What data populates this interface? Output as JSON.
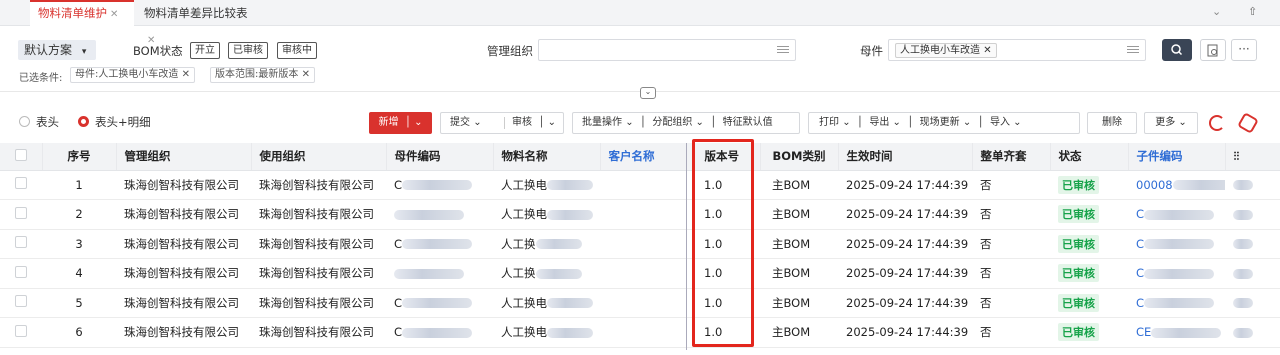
{
  "tabs": [
    {
      "label": "物料清单维护",
      "active": true
    },
    {
      "label": "物料清单差异比较表",
      "active": false
    }
  ],
  "tabbar_right": {
    "collapse": "⌄",
    "upload": "⇧"
  },
  "filter": {
    "scheme": "默认方案",
    "bom_status_label": "BOM状态",
    "bom_status_pills": [
      "开立",
      "已审核",
      "审核中"
    ],
    "org_label": "管理组织",
    "parent_label": "母件",
    "parent_tag": "人工换电小车改造",
    "conditions_label": "已选条件:",
    "conditions": [
      "母件:人工换电小车改造",
      "版本范围:最新版本"
    ]
  },
  "view": {
    "header_only": "表头",
    "header_detail": "表头+明细",
    "selected": "header_detail"
  },
  "toolbar": {
    "add": "新增",
    "submit": "提交",
    "audit": "审核",
    "batch": "批量操作",
    "assign_org": "分配组织",
    "feature_default": "特征默认值",
    "print": "打印",
    "export": "导出",
    "site_update": "现场更新",
    "import": "导入",
    "delete": "删除",
    "more": "更多"
  },
  "table": {
    "headers": [
      "序号",
      "管理组织",
      "使用组织",
      "母件编码",
      "物料名称",
      "客户名称",
      "版本号",
      "BOM类别",
      "生效时间",
      "整单齐套",
      "状态",
      "子件编码"
    ],
    "rows": [
      {
        "no": "1",
        "mgmt_org": "珠海创智科技有限公司",
        "use_org": "珠海创智科技有限公司",
        "parent_code": "C",
        "name": "人工换电",
        "customer": "",
        "version": "1.0",
        "bom_type": "主BOM",
        "effective": "2025-09-24 17:44:39",
        "complete": "否",
        "status": "已审核",
        "child_code": "00008"
      },
      {
        "no": "2",
        "mgmt_org": "珠海创智科技有限公司",
        "use_org": "珠海创智科技有限公司",
        "parent_code": "",
        "name": "人工换电",
        "customer": "",
        "version": "1.0",
        "bom_type": "主BOM",
        "effective": "2025-09-24 17:44:39",
        "complete": "否",
        "status": "已审核",
        "child_code": "C"
      },
      {
        "no": "3",
        "mgmt_org": "珠海创智科技有限公司",
        "use_org": "珠海创智科技有限公司",
        "parent_code": "C",
        "name": "人工换",
        "customer": "",
        "version": "1.0",
        "bom_type": "主BOM",
        "effective": "2025-09-24 17:44:39",
        "complete": "否",
        "status": "已审核",
        "child_code": "C"
      },
      {
        "no": "4",
        "mgmt_org": "珠海创智科技有限公司",
        "use_org": "珠海创智科技有限公司",
        "parent_code": "",
        "name": "人工换",
        "customer": "",
        "version": "1.0",
        "bom_type": "主BOM",
        "effective": "2025-09-24 17:44:39",
        "complete": "否",
        "status": "已审核",
        "child_code": "C"
      },
      {
        "no": "5",
        "mgmt_org": "珠海创智科技有限公司",
        "use_org": "珠海创智科技有限公司",
        "parent_code": "C",
        "name": "人工换电",
        "customer": "",
        "version": "1.0",
        "bom_type": "主BOM",
        "effective": "2025-09-24 17:44:39",
        "complete": "否",
        "status": "已审核",
        "child_code": "C"
      },
      {
        "no": "6",
        "mgmt_org": "珠海创智科技有限公司",
        "use_org": "珠海创智科技有限公司",
        "parent_code": "C",
        "name": "人工换电",
        "customer": "",
        "version": "1.0",
        "bom_type": "主BOM",
        "effective": "2025-09-24 17:44:39",
        "complete": "否",
        "status": "已审核",
        "child_code": "CE"
      }
    ]
  },
  "colors": {
    "accent": "#d9322d",
    "link": "#2f6dd5",
    "status_green": "#17a34a",
    "highlight": "#e3261d"
  }
}
